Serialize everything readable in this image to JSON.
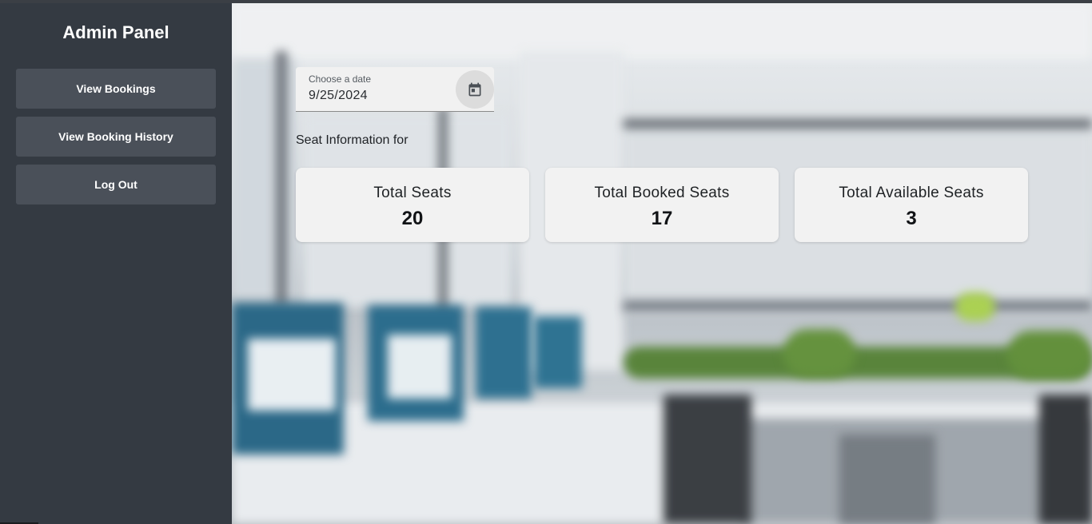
{
  "sidebar": {
    "title": "Admin Panel",
    "items": [
      {
        "label": "View Bookings"
      },
      {
        "label": "View Booking History"
      },
      {
        "label": "Log Out"
      }
    ]
  },
  "date_picker": {
    "label": "Choose a date",
    "value": "9/25/2024",
    "icon": "calendar-icon"
  },
  "seat_info": {
    "heading": "Seat Information for",
    "cards": [
      {
        "title": "Total Seats",
        "value": "20"
      },
      {
        "title": "Total Booked Seats",
        "value": "17"
      },
      {
        "title": "Total Available Seats",
        "value": "3"
      }
    ]
  },
  "colors": {
    "sidebar_bg": "#343a42",
    "button_bg": "#4a5059",
    "card_bg": "#f2f2f2"
  }
}
